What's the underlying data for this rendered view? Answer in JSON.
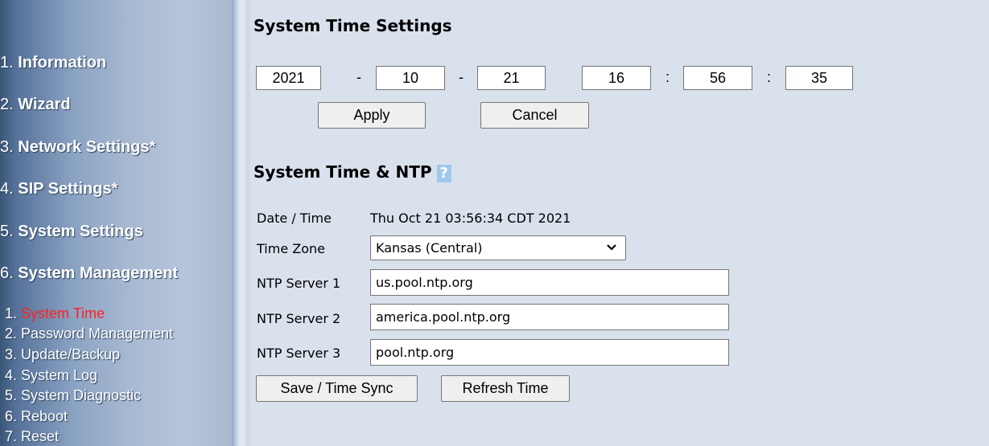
{
  "sidebar": {
    "items": [
      {
        "num": "1. ",
        "label": "Information"
      },
      {
        "num": "2. ",
        "label": "Wizard"
      },
      {
        "num": "3. ",
        "label": "Network Settings*"
      },
      {
        "num": "4. ",
        "label": "SIP Settings*"
      },
      {
        "num": "5. ",
        "label": "System Settings"
      },
      {
        "num": "6. ",
        "label": "System Management"
      }
    ],
    "subitems": [
      {
        "num": "1. ",
        "label": "System Time"
      },
      {
        "num": "2. ",
        "label": "Password Management"
      },
      {
        "num": "3. ",
        "label": "Update/Backup"
      },
      {
        "num": "4. ",
        "label": "System Log"
      },
      {
        "num": "5. ",
        "label": "System Diagnostic"
      },
      {
        "num": "6. ",
        "label": "Reboot"
      },
      {
        "num": "7. ",
        "label": "Reset"
      }
    ],
    "active_subitem": "System Time"
  },
  "system_time": {
    "heading": "System Time Settings",
    "year": "2021",
    "month": "10",
    "day": "21",
    "hour": "16",
    "minute": "56",
    "second": "35",
    "date_sep": "-",
    "time_sep": ":",
    "apply_label": "Apply",
    "cancel_label": "Cancel"
  },
  "ntp": {
    "heading": "System Time & NTP",
    "help_icon": "?",
    "date_time_label": "Date / Time",
    "date_time_value": "Thu Oct 21 03:56:34 CDT 2021",
    "time_zone_label": "Time Zone",
    "time_zone_value": "Kansas (Central)",
    "server1_label": "NTP Server 1",
    "server1_value": "us.pool.ntp.org",
    "server2_label": "NTP Server 2",
    "server2_value": "america.pool.ntp.org",
    "server3_label": "NTP Server 3",
    "server3_value": "pool.ntp.org",
    "save_label": "Save / Time Sync",
    "refresh_label": "Refresh Time"
  },
  "colors": {
    "page_bg": "#d9e1ec",
    "active_link": "#ff2020"
  }
}
